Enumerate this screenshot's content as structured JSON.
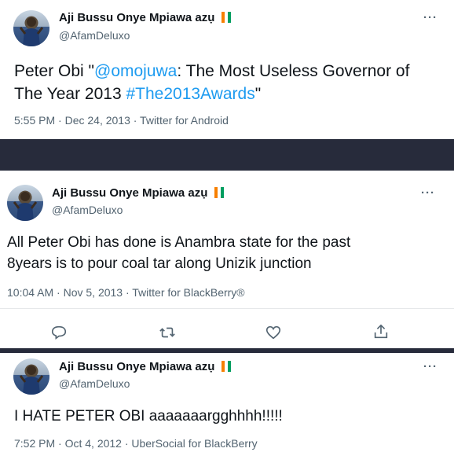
{
  "tweets": [
    {
      "display_name": "Aji Bussu Onye Mpiawa azụ",
      "handle": "@AfamDeluxo",
      "text_parts": [
        {
          "text": "Peter Obi \"",
          "link": false
        },
        {
          "text": "@omojuwa",
          "link": true
        },
        {
          "text": ": The Most Useless Governor of",
          "link": false
        }
      ],
      "text_line2_parts": [
        {
          "text": "The Year 2013 ",
          "link": false
        },
        {
          "text": "#The2013Awards",
          "link": true
        },
        {
          "text": "\"",
          "link": false
        }
      ],
      "timestamp": "5:55 PM · Dec 24, 2013 · Twitter for Android"
    },
    {
      "display_name": "Aji Bussu Onye Mpiawa azụ",
      "handle": "@AfamDeluxo",
      "text_line1": "All Peter Obi has done is Anambra state for the past",
      "text_line2": "8years is to pour coal tar along Unizik junction",
      "timestamp": "10:04 AM · Nov 5, 2013 · Twitter for BlackBerry®"
    },
    {
      "display_name": "Aji Bussu Onye Mpiawa azụ",
      "handle": "@AfamDeluxo",
      "text_line1": "I HATE PETER OBI aaaaaaargghhhh!!!!!",
      "timestamp": "7:52 PM · Oct 4, 2012 · UberSocial for BlackBerry"
    }
  ],
  "more_label": "···",
  "icons": [
    "reply-icon",
    "retweet-icon",
    "like-icon",
    "share-icon",
    "flag-icon",
    "more-icon"
  ],
  "colors": {
    "link": "#1d9bf0",
    "divider": "#272b3b",
    "secondary_text": "#536471"
  }
}
